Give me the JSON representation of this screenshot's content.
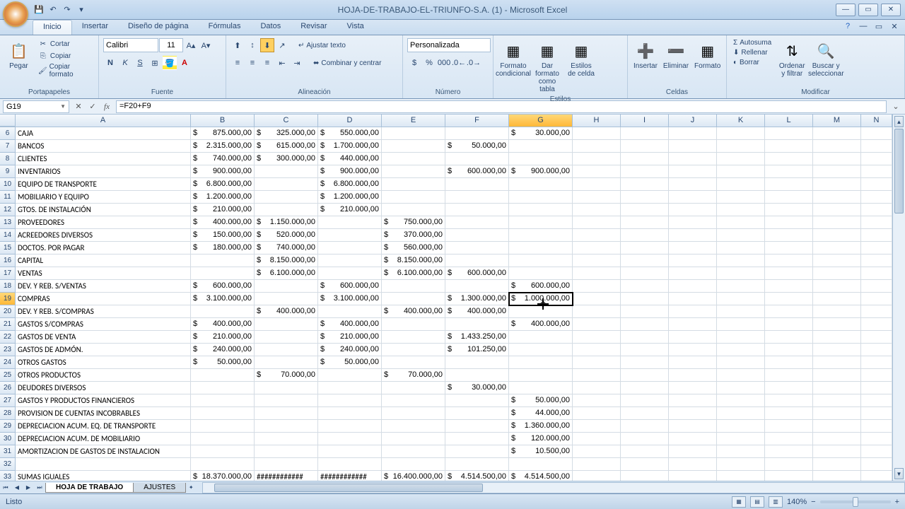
{
  "title": "HOJA-DE-TRABAJO-EL-TRIUNFO-S.A. (1) - Microsoft Excel",
  "ribbon": {
    "tabs": [
      "Inicio",
      "Insertar",
      "Diseño de página",
      "Fórmulas",
      "Datos",
      "Revisar",
      "Vista"
    ],
    "active_tab": 0,
    "clipboard": {
      "label": "Portapapeles",
      "paste": "Pegar",
      "cut": "Cortar",
      "copy": "Copiar",
      "format_painter": "Copiar formato"
    },
    "font": {
      "label": "Fuente",
      "name": "Calibri",
      "size": "11"
    },
    "align": {
      "label": "Alineación",
      "wrap": "Ajustar texto",
      "merge": "Combinar y centrar"
    },
    "number": {
      "label": "Número",
      "format": "Personalizada"
    },
    "styles": {
      "label": "Estilos",
      "cond": "Formato condicional",
      "table": "Dar formato como tabla",
      "cell": "Estilos de celda"
    },
    "cells": {
      "label": "Celdas",
      "insert": "Insertar",
      "delete": "Eliminar",
      "format": "Formato"
    },
    "editing": {
      "label": "Modificar",
      "autosum": "Autosuma",
      "fill": "Rellenar",
      "clear": "Borrar",
      "sort": "Ordenar y filtrar",
      "find": "Buscar y seleccionar"
    }
  },
  "namebox": "G19",
  "formula": "=F20+F9",
  "columns": [
    "A",
    "B",
    "C",
    "D",
    "E",
    "F",
    "G",
    "H",
    "I",
    "J",
    "K",
    "L",
    "M",
    "N"
  ],
  "selected_col": "G",
  "selected_row": 19,
  "rows": [
    {
      "n": 6,
      "a": "CAJA",
      "b": "875.000,00",
      "c": "325.000,00",
      "d": "550.000,00",
      "e": "",
      "f": "",
      "g": "30.000,00"
    },
    {
      "n": 7,
      "a": "BANCOS",
      "b": "2.315.000,00",
      "c": "615.000,00",
      "d": "1.700.000,00",
      "e": "",
      "f": "50.000,00",
      "g": ""
    },
    {
      "n": 8,
      "a": "CLIENTES",
      "b": "740.000,00",
      "c": "300.000,00",
      "d": "440.000,00",
      "e": "",
      "f": "",
      "g": ""
    },
    {
      "n": 9,
      "a": "INVENTARIOS",
      "b": "900.000,00",
      "c": "",
      "d": "900.000,00",
      "e": "",
      "f": "600.000,00",
      "g": "900.000,00"
    },
    {
      "n": 10,
      "a": "EQUIPO DE TRANSPORTE",
      "b": "6.800.000,00",
      "c": "",
      "d": "6.800.000,00",
      "e": "",
      "f": "",
      "g": ""
    },
    {
      "n": 11,
      "a": "MOBILIARIO Y EQUIPO",
      "b": "1.200.000,00",
      "c": "",
      "d": "1.200.000,00",
      "e": "",
      "f": "",
      "g": ""
    },
    {
      "n": 12,
      "a": "GTOS. DE INSTALACIÓN",
      "b": "210.000,00",
      "c": "",
      "d": "210.000,00",
      "e": "",
      "f": "",
      "g": ""
    },
    {
      "n": 13,
      "a": "PROVEEDORES",
      "b": "400.000,00",
      "c": "1.150.000,00",
      "d": "",
      "e": "750.000,00",
      "f": "",
      "g": ""
    },
    {
      "n": 14,
      "a": "ACREEDORES DIVERSOS",
      "b": "150.000,00",
      "c": "520.000,00",
      "d": "",
      "e": "370.000,00",
      "f": "",
      "g": ""
    },
    {
      "n": 15,
      "a": "DOCTOS. POR PAGAR",
      "b": "180.000,00",
      "c": "740.000,00",
      "d": "",
      "e": "560.000,00",
      "f": "",
      "g": ""
    },
    {
      "n": 16,
      "a": "CAPITAL",
      "b": "",
      "c": "8.150.000,00",
      "d": "",
      "e": "8.150.000,00",
      "f": "",
      "g": ""
    },
    {
      "n": 17,
      "a": "VENTAS",
      "b": "",
      "c": "6.100.000,00",
      "d": "",
      "e": "6.100.000,00",
      "f": "600.000,00",
      "g": ""
    },
    {
      "n": 18,
      "a": "DEV. Y REB. S/VENTAS",
      "b": "600.000,00",
      "c": "",
      "d": "600.000,00",
      "e": "",
      "f": "",
      "g": "600.000,00"
    },
    {
      "n": 19,
      "a": "COMPRAS",
      "b": "3.100.000,00",
      "c": "",
      "d": "3.100.000,00",
      "e": "",
      "f": "1.300.000,00",
      "g": "1.000.000,00",
      "selected": true
    },
    {
      "n": 20,
      "a": "DEV. Y REB. S/COMPRAS",
      "b": "",
      "c": "400.000,00",
      "d": "",
      "e": "400.000,00",
      "f": "400.000,00",
      "g": ""
    },
    {
      "n": 21,
      "a": "GASTOS S/COMPRAS",
      "b": "400.000,00",
      "c": "",
      "d": "400.000,00",
      "e": "",
      "f": "",
      "g": "400.000,00"
    },
    {
      "n": 22,
      "a": "GASTOS DE VENTA",
      "b": "210.000,00",
      "c": "",
      "d": "210.000,00",
      "e": "",
      "f": "1.433.250,00",
      "g": ""
    },
    {
      "n": 23,
      "a": "GASTOS DE ADMÓN.",
      "b": "240.000,00",
      "c": "",
      "d": "240.000,00",
      "e": "",
      "f": "101.250,00",
      "g": ""
    },
    {
      "n": 24,
      "a": "OTROS GASTOS",
      "b": "50.000,00",
      "c": "",
      "d": "50.000,00",
      "e": "",
      "f": "",
      "g": ""
    },
    {
      "n": 25,
      "a": "OTROS PRODUCTOS",
      "b": "",
      "c": "70.000,00",
      "d": "",
      "e": "70.000,00",
      "f": "",
      "g": ""
    },
    {
      "n": 26,
      "a": "DEUDORES DIVERSOS",
      "b": "",
      "c": "",
      "d": "",
      "e": "",
      "f": "30.000,00",
      "g": ""
    },
    {
      "n": 27,
      "a": "GASTOS Y PRODUCTOS FINANCIEROS",
      "b": "",
      "c": "",
      "d": "",
      "e": "",
      "f": "",
      "g": "50.000,00"
    },
    {
      "n": 28,
      "a": "PROVISION DE CUENTAS INCOBRABLES",
      "b": "",
      "c": "",
      "d": "",
      "e": "",
      "f": "",
      "g": "44.000,00"
    },
    {
      "n": 29,
      "a": "DEPRECIACION ACUM. EQ. DE TRANSPORTE",
      "b": "",
      "c": "",
      "d": "",
      "e": "",
      "f": "",
      "g": "1.360.000,00"
    },
    {
      "n": 30,
      "a": "DEPRECIACION ACUM. DE MOBILIARIO",
      "b": "",
      "c": "",
      "d": "",
      "e": "",
      "f": "",
      "g": "120.000,00"
    },
    {
      "n": 31,
      "a": "AMORTIZACION DE GASTOS DE INSTALACION",
      "b": "",
      "c": "",
      "d": "",
      "e": "",
      "f": "",
      "g": "10.500,00"
    },
    {
      "n": 32,
      "a": "",
      "b": "",
      "c": "",
      "d": "",
      "e": "",
      "f": "",
      "g": ""
    },
    {
      "n": 33,
      "a": "SUMAS IGUALES",
      "b": "18.370.000,00",
      "c": "############",
      "d": "############",
      "e": "16.400.000,00",
      "f": "4.514.500,00",
      "g": "4.514.500,00"
    }
  ],
  "sheet_tabs": [
    "HOJA DE TRABAJO",
    "AJUSTES"
  ],
  "active_sheet": 0,
  "status": "Listo",
  "zoom": "140%"
}
